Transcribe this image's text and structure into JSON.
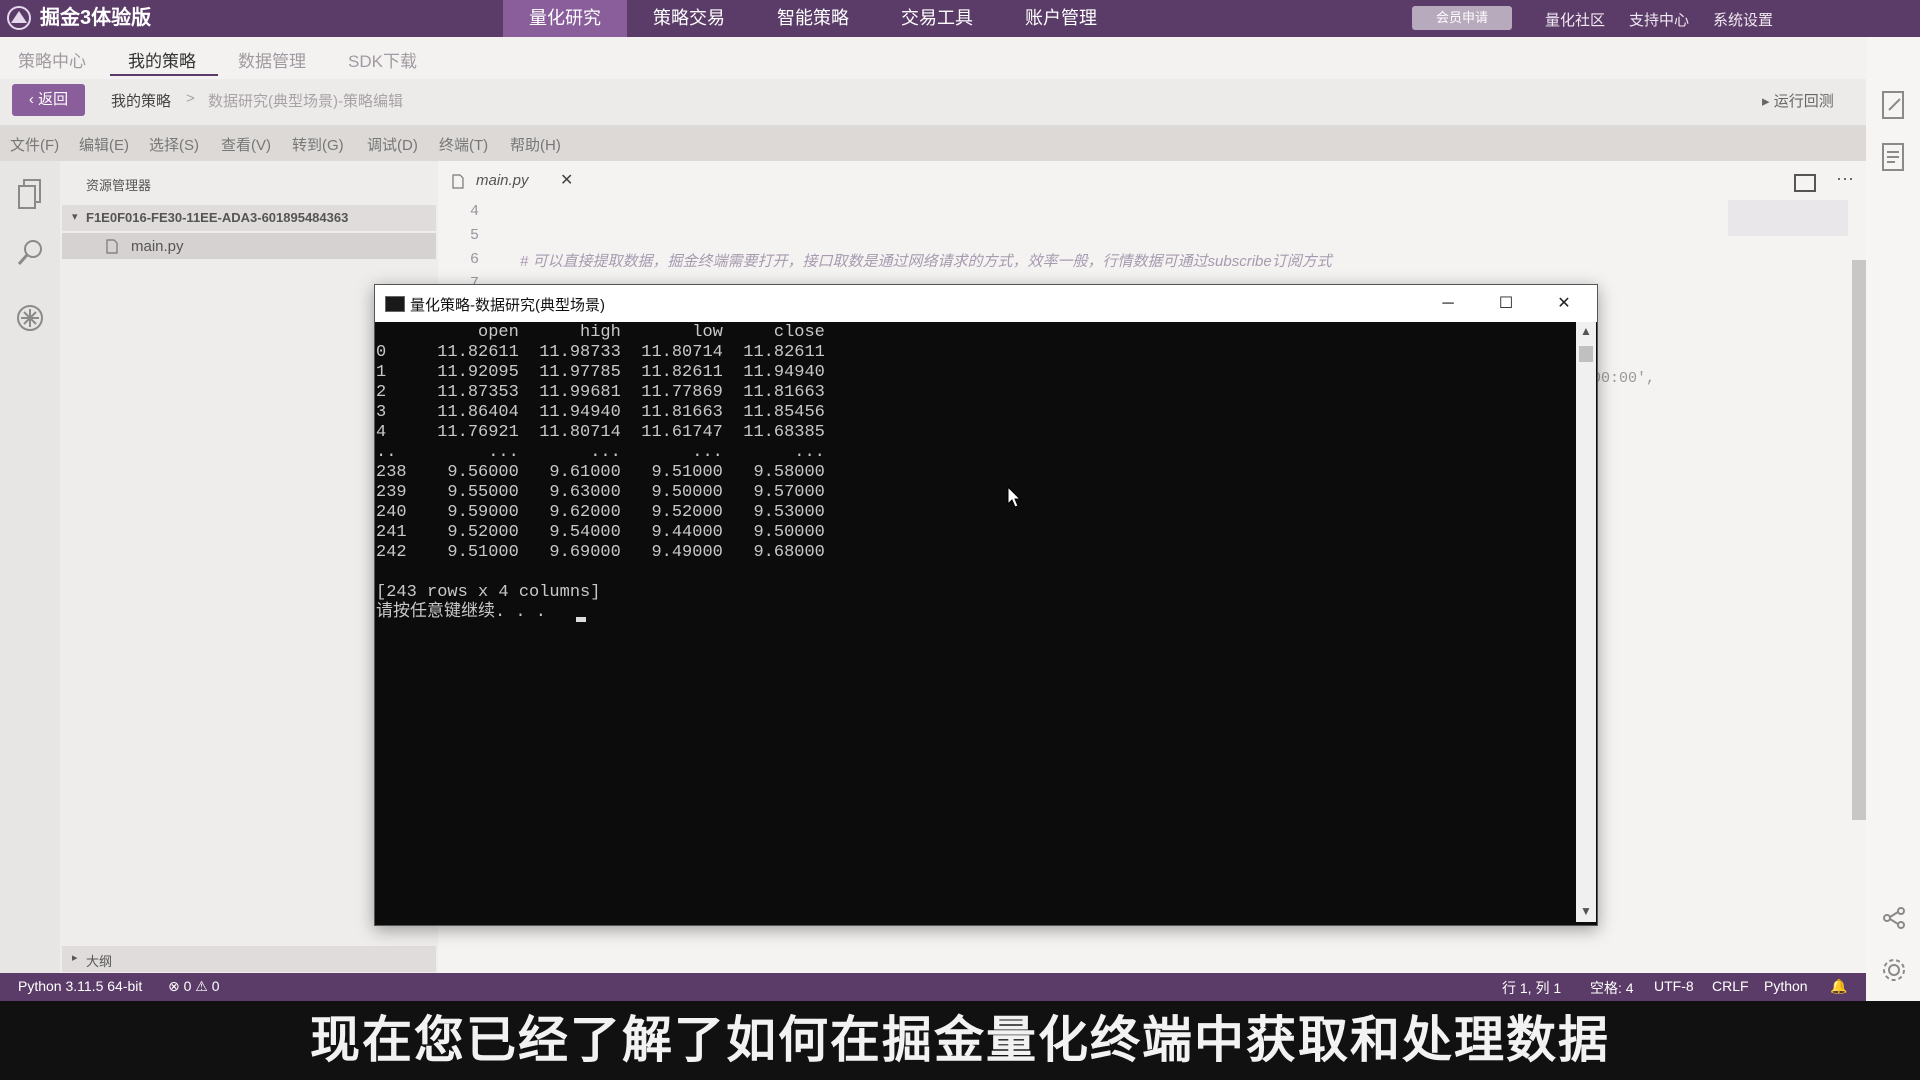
{
  "app": {
    "title": "掘金3体验版"
  },
  "topnav": {
    "items": [
      "量化研究",
      "策略交易",
      "智能策略",
      "交易工具",
      "账户管理"
    ],
    "vip_label": "会员申请",
    "links": [
      "量化社区",
      "支持中心",
      "系统设置"
    ]
  },
  "subnav": {
    "tabs": [
      "策略中心",
      "我的策略",
      "数据管理",
      "SDK下载"
    ]
  },
  "breadcrumb": {
    "back": "返回",
    "items": [
      "我的策略",
      ">",
      "数据研究(典型场景)-策略编辑"
    ],
    "run_back": "运行回测"
  },
  "menubar": [
    "文件(F)",
    "编辑(E)",
    "选择(S)",
    "查看(V)",
    "转到(G)",
    "调试(D)",
    "终端(T)",
    "帮助(H)"
  ],
  "explorer": {
    "title": "资源管理器",
    "folder": "F1E0F016-FE30-11EE-ADA3-601895484363",
    "file": "main.py",
    "outline": "大纲"
  },
  "editor": {
    "tab": "main.py",
    "line_numbers": [
      "4",
      "5",
      "6",
      "7"
    ],
    "comment": "# 可以直接提取数据，掘金终端需要打开，接口取数是通过网络请求的方式，效率一般，行情数据可通过subscribe订阅方式",
    "fragment": "00:00',"
  },
  "console": {
    "title": "量化策略-数据研究(典型场景)",
    "columns": [
      "open",
      "high",
      "low",
      "close"
    ],
    "rows": [
      [
        "0",
        "11.82611",
        "11.98733",
        "11.80714",
        "11.82611"
      ],
      [
        "1",
        "11.92095",
        "11.97785",
        "11.82611",
        "11.94940"
      ],
      [
        "2",
        "11.87353",
        "11.99681",
        "11.77869",
        "11.81663"
      ],
      [
        "3",
        "11.86404",
        "11.94940",
        "11.81663",
        "11.85456"
      ],
      [
        "4",
        "11.76921",
        "11.80714",
        "11.61747",
        "11.68385"
      ],
      [
        "..",
        "...",
        "...",
        "...",
        "..."
      ],
      [
        "238",
        "9.56000",
        "9.61000",
        "9.51000",
        "9.58000"
      ],
      [
        "239",
        "9.55000",
        "9.63000",
        "9.50000",
        "9.57000"
      ],
      [
        "240",
        "9.59000",
        "9.62000",
        "9.52000",
        "9.53000"
      ],
      [
        "241",
        "9.52000",
        "9.54000",
        "9.44000",
        "9.50000"
      ],
      [
        "242",
        "9.51000",
        "9.69000",
        "9.49000",
        "9.68000"
      ]
    ],
    "summary": "[243 rows x 4 columns]",
    "prompt": "请按任意键继续. . ."
  },
  "statusbar": {
    "python": "Python 3.11.5 64-bit",
    "problems": "⊗ 0 ⚠ 0",
    "position": "行 1, 列 1",
    "spaces": "空格: 4",
    "encoding": "UTF-8",
    "eol": "CRLF",
    "language": "Python"
  },
  "caption": "现在您已经了解了如何在掘金量化终端中获取和处理数据"
}
